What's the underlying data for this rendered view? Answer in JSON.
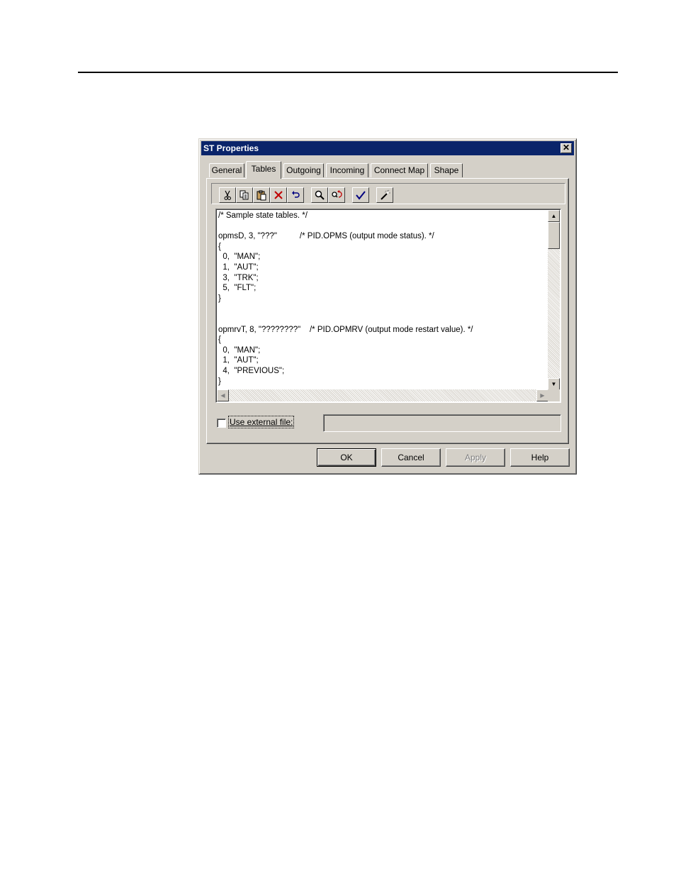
{
  "dialog": {
    "title": "ST Properties",
    "close_glyph": "✕"
  },
  "tabs": [
    {
      "label": "General",
      "active": false
    },
    {
      "label": "Tables",
      "active": true
    },
    {
      "label": "Outgoing",
      "active": false
    },
    {
      "label": "Incoming",
      "active": false
    },
    {
      "label": "Connect Map",
      "active": false
    },
    {
      "label": "Shape",
      "active": false
    }
  ],
  "toolbar": {
    "icons": [
      "cut-icon",
      "copy-icon",
      "paste-icon",
      "delete-icon",
      "undo-icon",
      "find-icon",
      "replace-icon",
      "check-icon",
      "wizard-icon"
    ]
  },
  "editor": {
    "lines": [
      "/* Sample state tables. */",
      "",
      "opmsD, 3, \"???\"          /* PID.OPMS (output mode status). */",
      "{",
      "  0,  \"MAN\";",
      "  1,  \"AUT\";",
      "  3,  \"TRK\";",
      "  5,  \"FLT\";",
      "}",
      "",
      "",
      "opmrvT, 8, \"????????\"    /* PID.OPMRV (output mode restart value). */",
      "{",
      "  0,  \"MAN\";",
      "  1,  \"AUT\";",
      "  4,  \"PREVIOUS\";",
      "}"
    ]
  },
  "external_file": {
    "label": "Use external file:",
    "checked": false,
    "value": ""
  },
  "buttons": {
    "ok": "OK",
    "cancel": "Cancel",
    "apply": "Apply",
    "help": "Help"
  }
}
